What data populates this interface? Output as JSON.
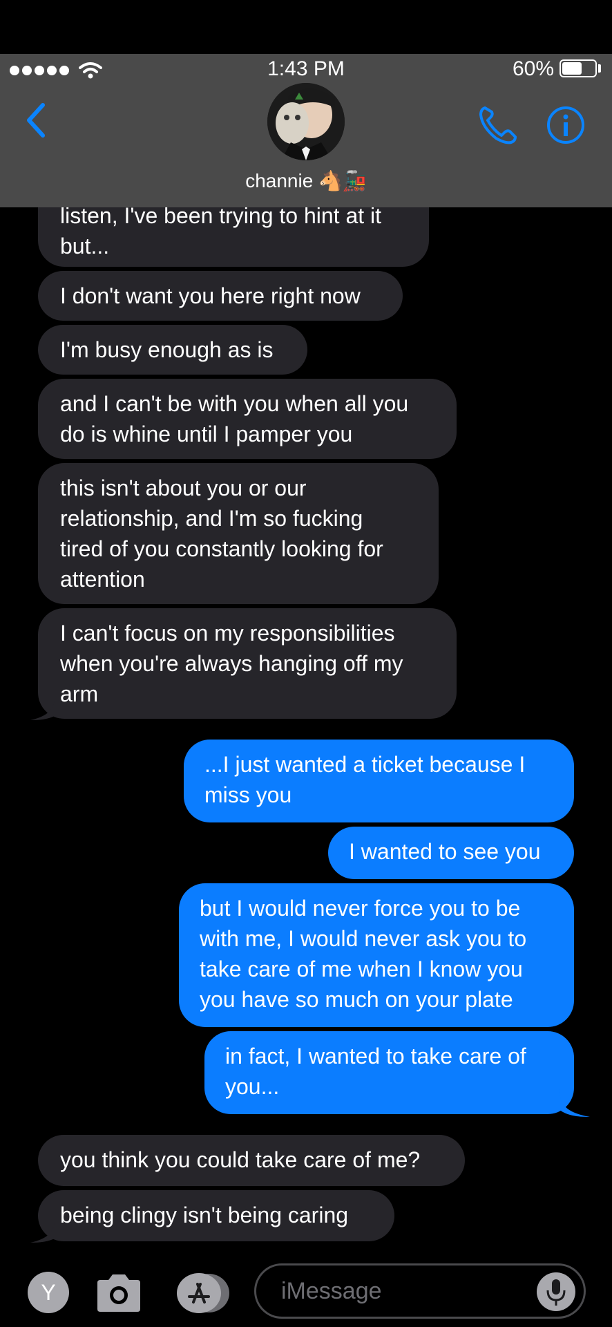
{
  "status_bar": {
    "time": "1:43 PM",
    "battery_percent_label": "60%",
    "battery_level": 0.6
  },
  "header": {
    "contact_name": "channie 🐴🚂"
  },
  "messages": [
    {
      "dir": "in",
      "text": "listen, I've been trying to hint at it\nbut..."
    },
    {
      "dir": "in",
      "text": "I don't want you here right now"
    },
    {
      "dir": "in",
      "text": "I'm busy enough as is"
    },
    {
      "dir": "in",
      "text": "and I can't be with you when all you\ndo is whine until I pamper you"
    },
    {
      "dir": "in",
      "text": "this isn't about you or our\nrelationship, and I'm so fucking\ntired of you constantly looking for\nattention"
    },
    {
      "dir": "in",
      "text": "I can't focus on my responsibilities\nwhen you're always hanging off my\narm"
    },
    {
      "dir": "out",
      "text": "...I just wanted a ticket because I\nmiss you"
    },
    {
      "dir": "out",
      "text": "I wanted to see you"
    },
    {
      "dir": "out",
      "text": "but I would never force you to be\nwith me, I would never ask you to\ntake care of me when I know you\nyou have so much on your plate"
    },
    {
      "dir": "out",
      "text": "in fact, I wanted to take care of\nyou..."
    },
    {
      "dir": "in",
      "text": "you think you could take care of me?"
    },
    {
      "dir": "in",
      "text": "being clingy isn't being caring"
    }
  ],
  "input": {
    "placeholder": "iMessage",
    "app_label": "Y"
  },
  "colors": {
    "incoming_bubble": "#26252a",
    "outgoing_bubble": "#0b7dff",
    "accent": "#0a84ff",
    "header_bg": "#4a4a4a"
  },
  "icons": [
    "back-chevron-icon",
    "phone-icon",
    "info-icon",
    "camera-icon",
    "app-store-icon",
    "microphone-icon",
    "wifi-icon"
  ]
}
